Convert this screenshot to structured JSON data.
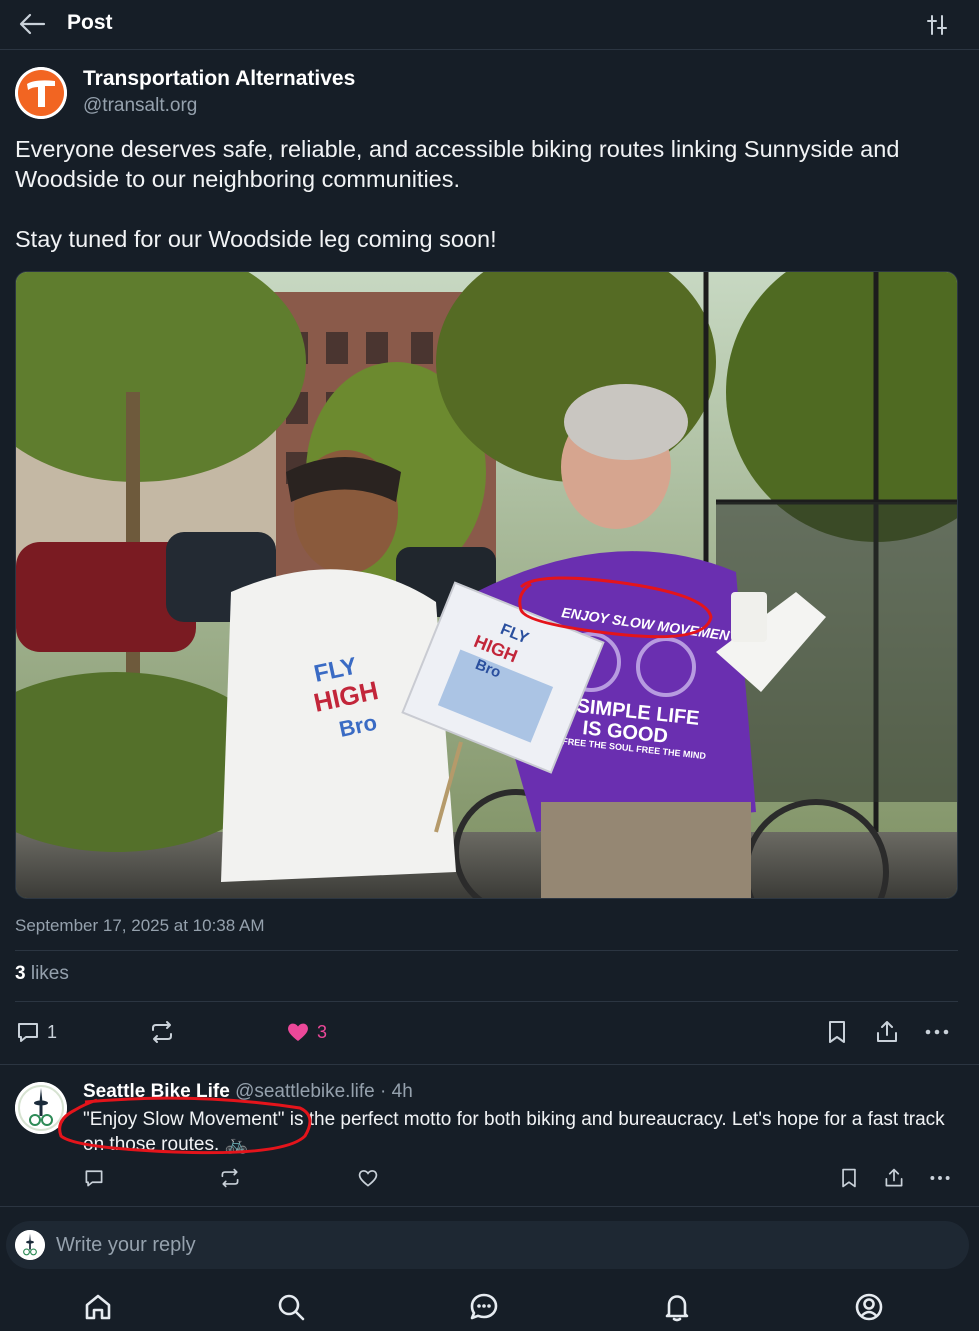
{
  "header": {
    "title": "Post",
    "back_icon": "arrow-left-icon",
    "filter_icon": "sliders-icon"
  },
  "post": {
    "author_name": "Transportation Alternatives",
    "author_handle": "@transalt.org",
    "text_p1": "Everyone deserves safe, reliable, and accessible biking routes linking Sunnyside and Woodside to our neighboring communities.",
    "text_p2": "Stay tuned for our Woodside leg coming soon!",
    "photo": {
      "shirt_text_1": "ENJOY SLOW MOVEMENT",
      "shirt_text_2": "SIMPLE LIFE",
      "shirt_text_3": "IS GOOD",
      "shirt_text_4": "FREE THE SOUL FREE THE MIND",
      "sign_text_1": "FLY",
      "sign_text_2": "HIGH",
      "sign_text_3": "Bro",
      "left_shirt_text_1": "FLY",
      "left_shirt_text_2": "HIGH",
      "left_shirt_text_3": "Bro"
    },
    "timestamp": "September 17, 2025 at 10:38 AM",
    "likes_count": "3",
    "likes_label": " likes",
    "actions": {
      "reply_count": "1",
      "like_count": "3"
    }
  },
  "reply": {
    "author_name": "Seattle Bike Life",
    "author_handle": "@seattlebike.life",
    "time": " · 4h",
    "text": "\"Enjoy Slow Movement\" is the perfect motto for both biking and bureaucracy. Let's hope for a fast track on those routes. 🚲"
  },
  "composer": {
    "placeholder": "Write your reply"
  },
  "bottom_nav": [
    "home-icon",
    "search-icon",
    "chat-icon",
    "bell-icon",
    "profile-icon"
  ],
  "colors": {
    "background": "#161e27",
    "like_pink": "#ec4899",
    "brand_orange": "#f26522",
    "annotation_red": "#e4141b"
  }
}
